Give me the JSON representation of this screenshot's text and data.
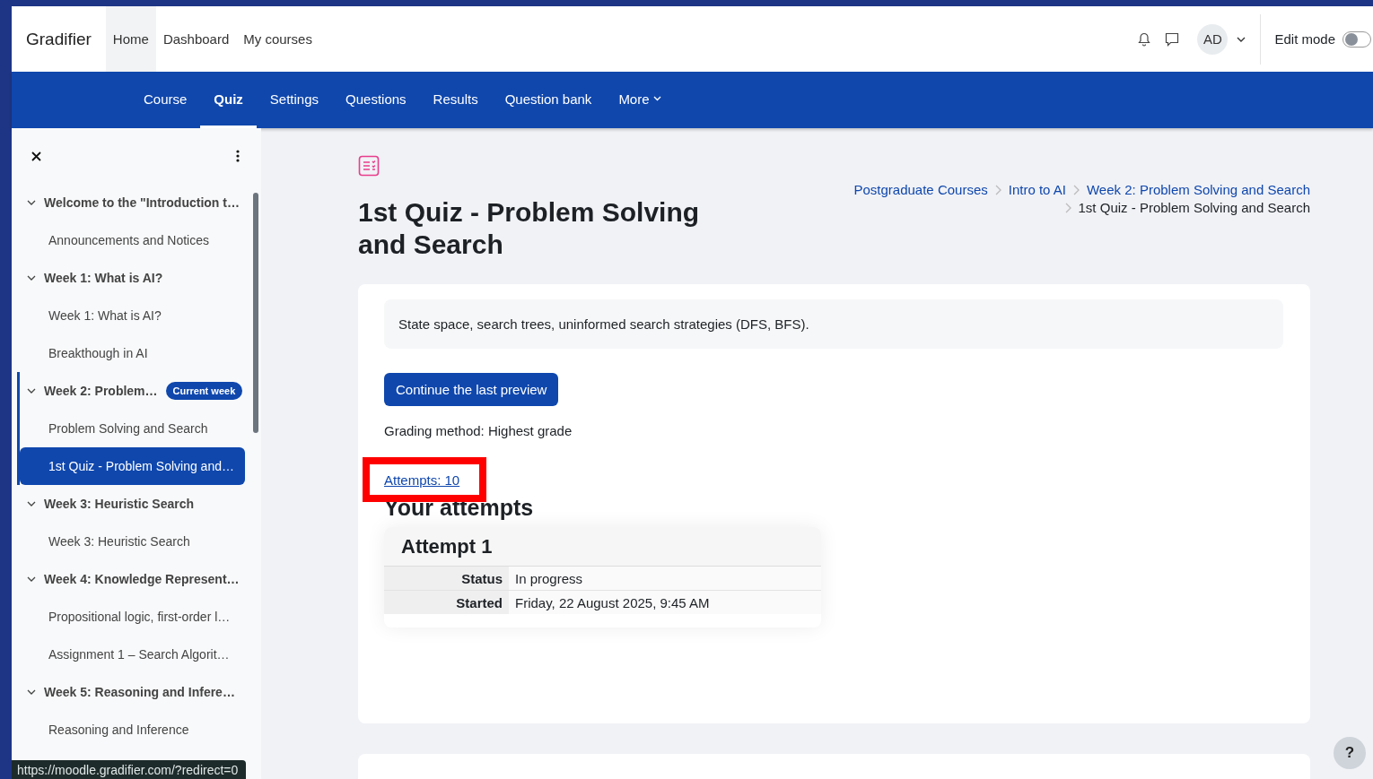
{
  "header": {
    "brand": "Gradifier",
    "nav": [
      {
        "label": "Home",
        "selected": true
      },
      {
        "label": "Dashboard",
        "selected": false
      },
      {
        "label": "My courses",
        "selected": false
      }
    ],
    "avatar": "AD",
    "edit_mode": {
      "label": "Edit mode",
      "on": false
    }
  },
  "secondary_nav": [
    {
      "label": "Course",
      "selected": false,
      "kind": "link"
    },
    {
      "label": "Quiz",
      "selected": true,
      "kind": "link"
    },
    {
      "label": "Settings",
      "selected": false,
      "kind": "link"
    },
    {
      "label": "Questions",
      "selected": false,
      "kind": "link"
    },
    {
      "label": "Results",
      "selected": false,
      "kind": "link"
    },
    {
      "label": "Question bank",
      "selected": false,
      "kind": "link"
    },
    {
      "label": "More",
      "selected": false,
      "kind": "menu"
    }
  ],
  "course_index": {
    "sections": [
      {
        "title": "Welcome to the \"Introduction t…",
        "expanded": true,
        "current": false,
        "children": [
          {
            "title": "Announcements and Notices",
            "selected": false
          }
        ]
      },
      {
        "title": "Week 1: What is AI?",
        "expanded": true,
        "current": false,
        "children": [
          {
            "title": "Week 1: What is AI?",
            "selected": false
          },
          {
            "title": "Breakthough in AI",
            "selected": false
          }
        ]
      },
      {
        "title": "Week 2: Problem…",
        "expanded": true,
        "current": true,
        "badge": "Current week",
        "children": [
          {
            "title": "Problem Solving and Search",
            "selected": false
          },
          {
            "title": "1st Quiz - Problem Solving and…",
            "selected": true
          }
        ]
      },
      {
        "title": "Week 3: Heuristic Search",
        "expanded": true,
        "current": false,
        "children": [
          {
            "title": "Week 3: Heuristic Search",
            "selected": false
          }
        ]
      },
      {
        "title": "Week 4: Knowledge Represent…",
        "expanded": true,
        "current": false,
        "children": [
          {
            "title": "Propositional logic, first-order l…",
            "selected": false
          },
          {
            "title": "Assignment 1 – Search Algorit…",
            "selected": false
          }
        ]
      },
      {
        "title": "Week 5: Reasoning and Infere…",
        "expanded": true,
        "current": false,
        "children": [
          {
            "title": "Reasoning and Inference",
            "selected": false
          }
        ]
      }
    ]
  },
  "page": {
    "title": "1st Quiz - Problem Solving and Search",
    "breadcrumb": [
      {
        "label": "Postgraduate Courses",
        "link": true
      },
      {
        "label": "Intro to AI",
        "link": true
      },
      {
        "label": "Week 2: Problem Solving and Search",
        "link": true
      },
      {
        "label": "1st Quiz - Problem Solving and Search",
        "link": false
      }
    ],
    "description": "State space, search trees, uninformed search strategies (DFS, BFS).",
    "continue_button": "Continue the last preview",
    "grading_method": "Grading method: Highest grade",
    "attempts_link": {
      "label": "Attempts: 10",
      "highlighted": true
    },
    "attempts_heading": "Your attempts",
    "attempts": [
      {
        "title": "Attempt 1",
        "rows": [
          {
            "label": "Status",
            "value": "In progress"
          },
          {
            "label": "Started",
            "value": "Friday, 22 August 2025, 9:45 AM"
          }
        ]
      }
    ]
  },
  "status_url": "https://moodle.gradifier.com/?redirect=0",
  "help": "?"
}
